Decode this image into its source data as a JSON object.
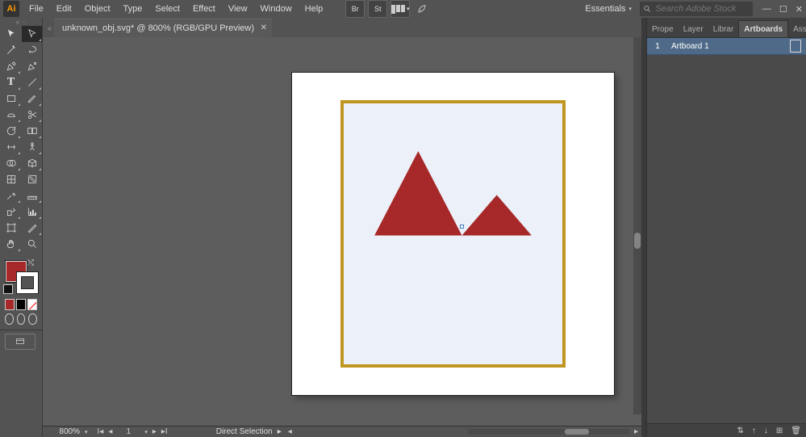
{
  "app": {
    "logo": "Ai"
  },
  "menu": [
    "File",
    "Edit",
    "Object",
    "Type",
    "Select",
    "Effect",
    "View",
    "Window",
    "Help"
  ],
  "workspace": {
    "label": "Essentials"
  },
  "search": {
    "placeholder": "Search Adobe Stock"
  },
  "document": {
    "tab_title": "unknown_obj.svg* @ 800% (RGB/GPU Preview)"
  },
  "status": {
    "zoom": "800%",
    "artboard_page": "1",
    "selection_info": "Direct Selection"
  },
  "panels": {
    "tabs": [
      "Prope",
      "Layer",
      "Librar",
      "Artboards",
      "Asset"
    ],
    "active_tab_index": 3
  },
  "artboards": [
    {
      "index": "1",
      "name": "Artboard 1"
    }
  ],
  "colors": {
    "fill": "#a72828",
    "stroke": "#ffffff",
    "artboard_border": "#bf9720",
    "artboard_inner": "#ecf0f9"
  },
  "chart_data": {
    "type": "other",
    "note": "Freeform vector artwork: two red triangles inside a tan-bordered pale-blue square on a white artboard.",
    "shapes": [
      {
        "kind": "rect",
        "stroke": "#bf9720",
        "stroke_width": 4,
        "fill": "#ecf0f9"
      },
      {
        "kind": "triangle",
        "fill": "#a72828",
        "relative_points": [
          [
            0.14,
            0.51
          ],
          [
            0.34,
            0.19
          ],
          [
            0.54,
            0.51
          ]
        ]
      },
      {
        "kind": "triangle",
        "fill": "#a72828",
        "relative_points": [
          [
            0.54,
            0.51
          ],
          [
            0.7,
            0.25
          ],
          [
            0.86,
            0.51
          ]
        ]
      }
    ]
  }
}
